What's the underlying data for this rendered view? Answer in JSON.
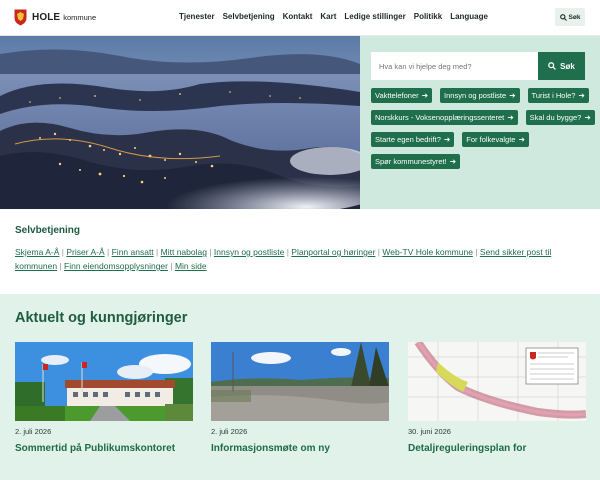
{
  "header": {
    "logo_name": "HOLE",
    "logo_sub": "kommune",
    "nav": [
      "Tjenester",
      "Selvbetjening",
      "Kontakt",
      "Kart",
      "Ledige stillinger",
      "Politikk",
      "Language"
    ],
    "search_label": "Søk"
  },
  "hero": {
    "search_placeholder": "Hva kan vi hjelpe deg med?",
    "search_button": "Søk",
    "quick_links": [
      "Vakttelefoner",
      "Innsyn og postliste",
      "Turist i Hole?",
      "Norskkurs - Voksenopplæringssenteret",
      "Skal du bygge?",
      "Starte egen bedrift?",
      "For folkevalgte",
      "Spør kommunestyret!"
    ]
  },
  "selvbetjening": {
    "title": "Selvbetjening",
    "links": [
      "Skjema A-Å",
      "Priser A-Å",
      "Finn ansatt",
      "Mitt nabolag",
      "Innsyn og postliste",
      "Planportal og høringer",
      "Web-TV Hole kommune",
      "Send sikker post til kommunen",
      "Finn eiendomsopplysninger",
      "Min side"
    ],
    "separator": "|"
  },
  "news": {
    "title": "Aktuelt og kunngjøringer",
    "cards": [
      {
        "date": "2. juli 2026",
        "title": "Sommertid på Publikumskontoret"
      },
      {
        "date": "2. juli 2026",
        "title": "Informasjonsmøte om ny"
      },
      {
        "date": "30. juni 2026",
        "title": "Detaljreguleringsplan for"
      }
    ]
  },
  "colors": {
    "brand": "#1f6e4c",
    "hero_bg": "#cfe9de",
    "news_bg": "#e1f2ea"
  }
}
